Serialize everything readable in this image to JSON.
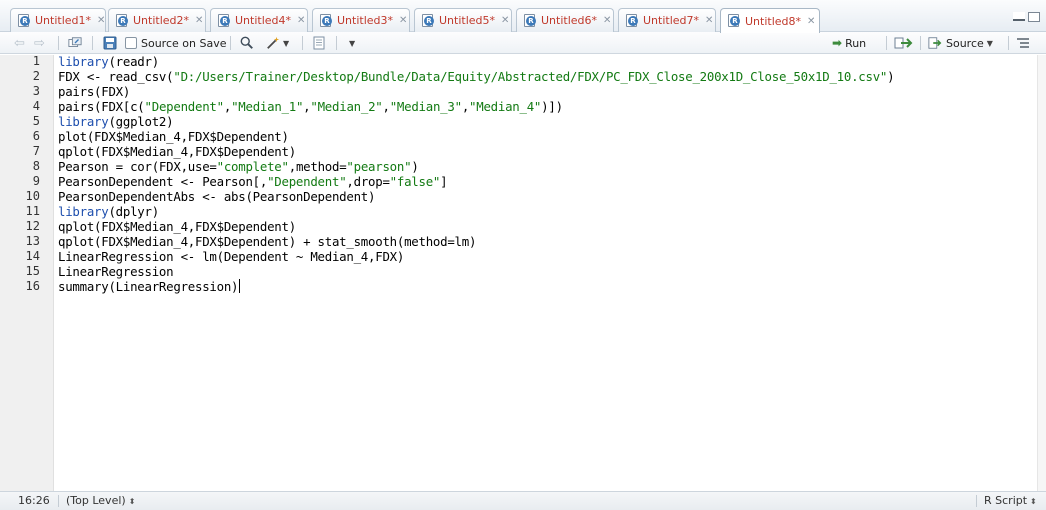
{
  "tabs": [
    {
      "label": "Untitled1*",
      "active": false
    },
    {
      "label": "Untitled2*",
      "active": false
    },
    {
      "label": "Untitled4*",
      "active": false
    },
    {
      "label": "Untitled3*",
      "active": false
    },
    {
      "label": "Untitled5*",
      "active": false
    },
    {
      "label": "Untitled6*",
      "active": false
    },
    {
      "label": "Untitled7*",
      "active": false
    },
    {
      "label": "Untitled8*",
      "active": true
    }
  ],
  "toolbar": {
    "source_on_save_label": "Source on Save",
    "run_label": "Run",
    "source_label": "Source"
  },
  "editor": {
    "line_numbers": [
      "1",
      "2",
      "3",
      "4",
      "5",
      "6",
      "7",
      "8",
      "9",
      "10",
      "11",
      "12",
      "13",
      "14",
      "15",
      "16"
    ],
    "lines": [
      "library(readr)",
      "FDX <- read_csv(\"D:/Users/Trainer/Desktop/Bundle/Data/Equity/Abstracted/FDX/PC_FDX_Close_200x1D_Close_50x1D_10.csv\")",
      "pairs(FDX)",
      "pairs(FDX[c(\"Dependent\",\"Median_1\",\"Median_2\",\"Median_3\",\"Median_4\")])",
      "library(ggplot2)",
      "plot(FDX$Median_4,FDX$Dependent)",
      "qplot(FDX$Median_4,FDX$Dependent)",
      "Pearson = cor(FDX,use=\"complete\",method=\"pearson\")",
      "PearsonDependent <- Pearson[,\"Dependent\",drop=\"false\"]",
      "PearsonDependentAbs <- abs(PearsonDependent)",
      "library(dplyr)",
      "qplot(FDX$Median_4,FDX$Dependent)",
      "qplot(FDX$Median_4,FDX$Dependent) + stat_smooth(method=lm)",
      "LinearRegression <- lm(Dependent ~ Median_4,FDX)",
      "LinearRegression",
      "summary(LinearRegression)"
    ]
  },
  "status": {
    "cursor_position": "16:26",
    "scope": "(Top Level)",
    "file_type": "R Script"
  },
  "colors": {
    "keyword": "#1e4fae",
    "string": "#137a13",
    "tab_label": "#c0392b"
  },
  "icons": [
    "r-script-icon",
    "close-icon",
    "back-arrow-icon",
    "forward-arrow-icon",
    "show-in-window-icon",
    "save-icon",
    "find-icon",
    "magic-wand-icon",
    "compile-report-icon",
    "run-arrow-icon",
    "rerun-icon",
    "source-icon",
    "outline-icon"
  ]
}
